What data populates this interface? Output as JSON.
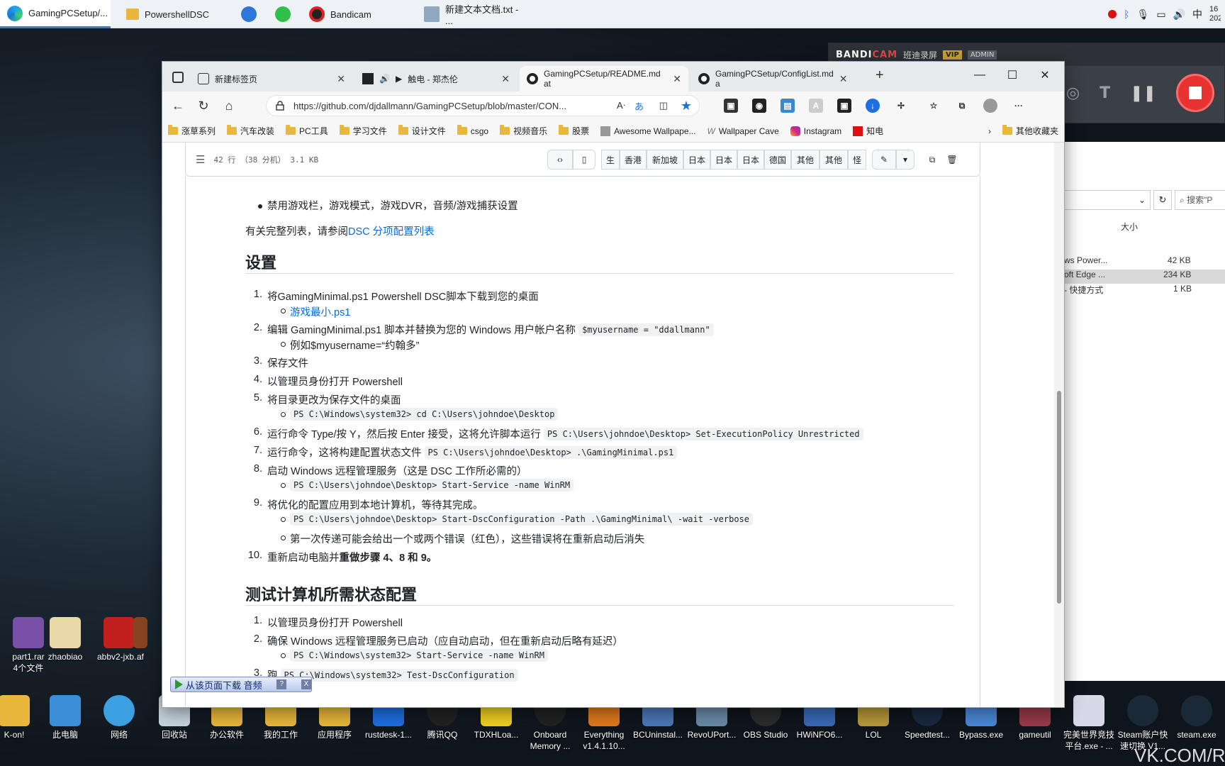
{
  "taskbar": {
    "items": [
      {
        "label": "GamingPCSetup/...",
        "active": true
      },
      {
        "label": "PowershellDSC"
      },
      {
        "label": ""
      },
      {
        "label": ""
      },
      {
        "label": "Bandicam"
      },
      {
        "label": "新建文本文档.txt - ..."
      }
    ],
    "tray_ime": "中",
    "clock_partial": "16",
    "date_partial": "202"
  },
  "bandicam": {
    "logo_main": "BANDI",
    "logo_accent": "CAM",
    "subtitle": "班迪录屏",
    "vip": "VIP",
    "admin": "ADMIN"
  },
  "explorer": {
    "search_placeholder": "搜索\"P",
    "col_size": "大小",
    "rows": [
      {
        "name": "ws Power...",
        "size": "42 KB"
      },
      {
        "name": "oft Edge ...",
        "size": "234 KB"
      },
      {
        "name": "- 快捷方式",
        "size": "1 KB"
      }
    ]
  },
  "browser": {
    "tabs": [
      {
        "label": "新建标签页"
      },
      {
        "label": "触电 - 郑杰伦"
      },
      {
        "label": "GamingPCSetup/README.md at",
        "active": true
      },
      {
        "label": "GamingPCSetup/ConfigList.md a"
      }
    ],
    "url": "https://github.com/djdallmann/GamingPCSetup/blob/master/CON...",
    "bookmarks": [
      "涨草系列",
      "汽车改装",
      "PC工具",
      "学习文件",
      "设计文件",
      "csgo",
      "视频音乐",
      "股票",
      "Awesome Wallpape...",
      "Wallpaper Cave",
      "Instagram",
      "知电"
    ],
    "bookmarks_other": "其他收藏夹"
  },
  "filebar": {
    "lines": "42 行 （38 分机） 3.1 KB",
    "buttons": [
      "生",
      "香港",
      "新加坡",
      "日本",
      "日本",
      "日本",
      "德国",
      "其他",
      "其他",
      "怪"
    ]
  },
  "content": {
    "top_bullet": "禁用游戏栏，游戏模式，游戏DVR，音频/游戏捕获设置",
    "full_list_prefix": "有关完整列表，请参阅 ",
    "full_list_link": "DSC 分项配置列表",
    "setup_heading": "设置",
    "setup_steps": [
      {
        "n": "1.",
        "text": "将GamingMinimal.ps1 Powershell DSC脚本下载到您的桌面"
      },
      {
        "n": "2.",
        "text": "编辑 GamingMinimal.ps1 脚本并替换为您的 Windows 用户帐户名称",
        "code": "$myusername = \"ddallmann\""
      },
      {
        "n": "3.",
        "text": "保存文件"
      },
      {
        "n": "4.",
        "text": "以管理员身份打开 Powershell"
      },
      {
        "n": "5.",
        "text": "将目录更改为保存文件的桌面"
      },
      {
        "n": "6.",
        "text": "运行命令 Type/按 Y，然后按 Enter 接受，这将允许脚本运行",
        "code": "PS C:\\Users\\johndoe\\Desktop> Set-ExecutionPolicy Unrestricted"
      },
      {
        "n": "7.",
        "text": "运行命令，这将构建配置状态文件",
        "code": "PS C:\\Users\\johndoe\\Desktop> .\\GamingMinimal.ps1"
      },
      {
        "n": "8.",
        "text": "启动 Windows 远程管理服务（这是 DSC 工作所必需的）"
      },
      {
        "n": "9.",
        "text": "将优化的配置应用到本地计算机，等待其完成。"
      },
      {
        "n": "10.",
        "text": "重新启动电脑并",
        "bold": "重做步骤 4、8 和 9。"
      }
    ],
    "sub_1_link": "游戏最小.ps1",
    "sub_2": "例如$myusername=“约翰多”",
    "sub_5_code": "PS C:\\Windows\\system32> cd C:\\Users\\johndoe\\Desktop",
    "sub_8_code": "PS C:\\Users\\johndoe\\Desktop> Start-Service -name WinRM",
    "sub_9_code": "PS C:\\Users\\johndoe\\Desktop> Start-DscConfiguration -Path .\\GamingMinimal\\ -wait -verbose",
    "sub_9_text": "第一次传递可能会给出一个或两个错误（红色），这些错误将在重新启动后消失",
    "test_heading": "测试计算机所需状态配置",
    "test_steps": [
      {
        "n": "1.",
        "text": "以管理员身份打开 Powershell"
      },
      {
        "n": "2.",
        "text": "确保 Windows 远程管理服务已启动（应自动启动，但在重新启动后略有延迟）"
      },
      {
        "n": "3.",
        "text": "跑",
        "code": "PS C:\\Windows\\system32> Test-DscConfiguration"
      }
    ],
    "test_sub_2_code": "PS C:\\Windows\\system32> Start-Service -name WinRM"
  },
  "download_bar": {
    "label": "从该页面下载 音频",
    "help": "?",
    "close": "X"
  },
  "desktop_icons": [
    {
      "label": "part1.rar"
    },
    {
      "label": "4个文件"
    },
    {
      "label": "zhaobiao"
    },
    {
      "label": "abbv2-jxb..."
    },
    {
      "label": "af"
    },
    {
      "label": "K-on!"
    },
    {
      "label": "此电脑"
    },
    {
      "label": "网络"
    },
    {
      "label": "回收站"
    },
    {
      "label": "办公软件"
    },
    {
      "label": "我的工作"
    },
    {
      "label": "应用程序"
    },
    {
      "label": "rustdesk-1..."
    },
    {
      "label": "腾讯QQ"
    },
    {
      "label": "TDXHLoa..."
    },
    {
      "label": "Onboard"
    },
    {
      "label": "Memory ..."
    },
    {
      "label": "Everything"
    },
    {
      "label": "v1.4.1.10..."
    },
    {
      "label": "BCUninstal..."
    },
    {
      "label": "RevoUPort..."
    },
    {
      "label": "OBS Studio"
    },
    {
      "label": "HWiNFO6..."
    },
    {
      "label": "LOL"
    },
    {
      "label": "Speedtest..."
    },
    {
      "label": "Bypass.exe"
    },
    {
      "label": "gameutil"
    },
    {
      "label": "完美世界竞技"
    },
    {
      "label": "平台.exe - ..."
    },
    {
      "label": "Steam账户快"
    },
    {
      "label": "速切换 V1..."
    },
    {
      "label": "steam.exe"
    }
  ],
  "watermark": "VK.COM/R"
}
